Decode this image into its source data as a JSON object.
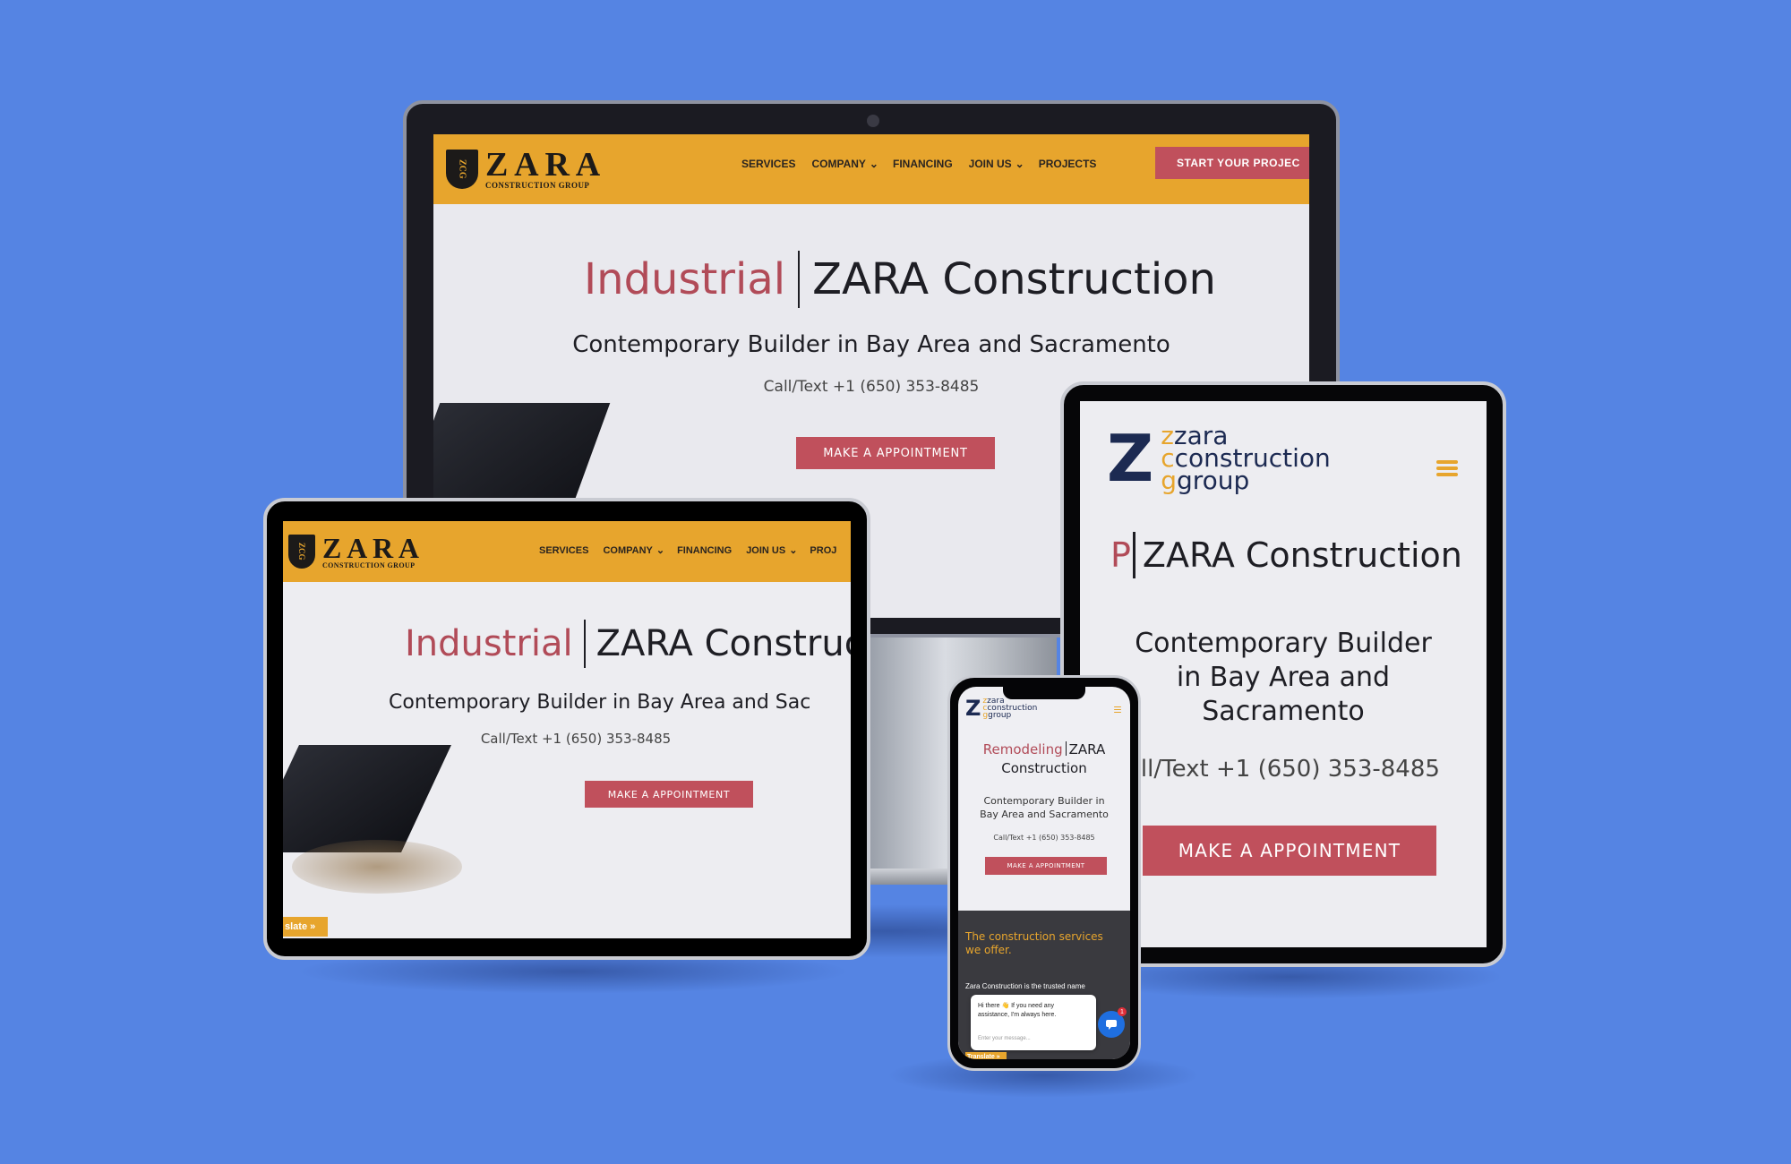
{
  "brand": {
    "logo_mark": "ZCG",
    "logo_main": "ZARA",
    "logo_sub": "CONSTRUCTION GROUP",
    "alt_logo_mark": "Z",
    "alt_logo_lines": [
      "zara",
      "construction",
      "group"
    ],
    "alt_logo_initials": [
      "z",
      "c",
      "g"
    ]
  },
  "nav": {
    "items": [
      "SERVICES",
      "COMPANY",
      "FINANCING",
      "JOIN US",
      "PROJECTS"
    ],
    "left_tablet_items": [
      "SERVICES",
      "COMPANY",
      "FINANCING",
      "JOIN US",
      "PROJ"
    ],
    "dropdown_marker": "⌄",
    "cta_label": "START YOUR PROJEC"
  },
  "hero": {
    "accent_desktop": "Industrial",
    "accent_phone": "Remodeling",
    "accent_right_tablet": "P",
    "title": "ZARA Construction",
    "title_left_tablet": "ZARA Construc",
    "phone_title_line1": "ZARA",
    "phone_title_line2": "Construction",
    "subtitle": "Contemporary Builder in Bay Area and Sacramento",
    "subtitle_left_tablet": "Contemporary Builder in Bay Area and Sac",
    "subtitle_right_lines": [
      "Contemporary Builder",
      "in Bay Area and",
      "Sacramento"
    ],
    "subtitle_phone_lines": [
      "Contemporary Builder in",
      "Bay Area and Sacramento"
    ],
    "phone": "Call/Text +1 (650) 353-8485",
    "phone_right_tablet": "all/Text +1 (650) 353-8485",
    "appointment_label": "MAKE A APPOINTMENT"
  },
  "widgets": {
    "translate_left": "slate »",
    "translate_phone": "Translate »",
    "services_heading_lines": [
      "The construction services",
      "we offer."
    ],
    "services_text": "Zara Construction is the trusted name",
    "chat_message_lines": [
      "Hi there 👋 If you need any",
      "assistance, I'm always here."
    ],
    "chat_placeholder": "Enter your message...",
    "chat_badge": "1"
  },
  "colors": {
    "background": "#5584e3",
    "header_gold": "#e7a52d",
    "accent_red": "#c0505c",
    "accent_text": "#b14b58",
    "navy": "#1c2a52"
  }
}
